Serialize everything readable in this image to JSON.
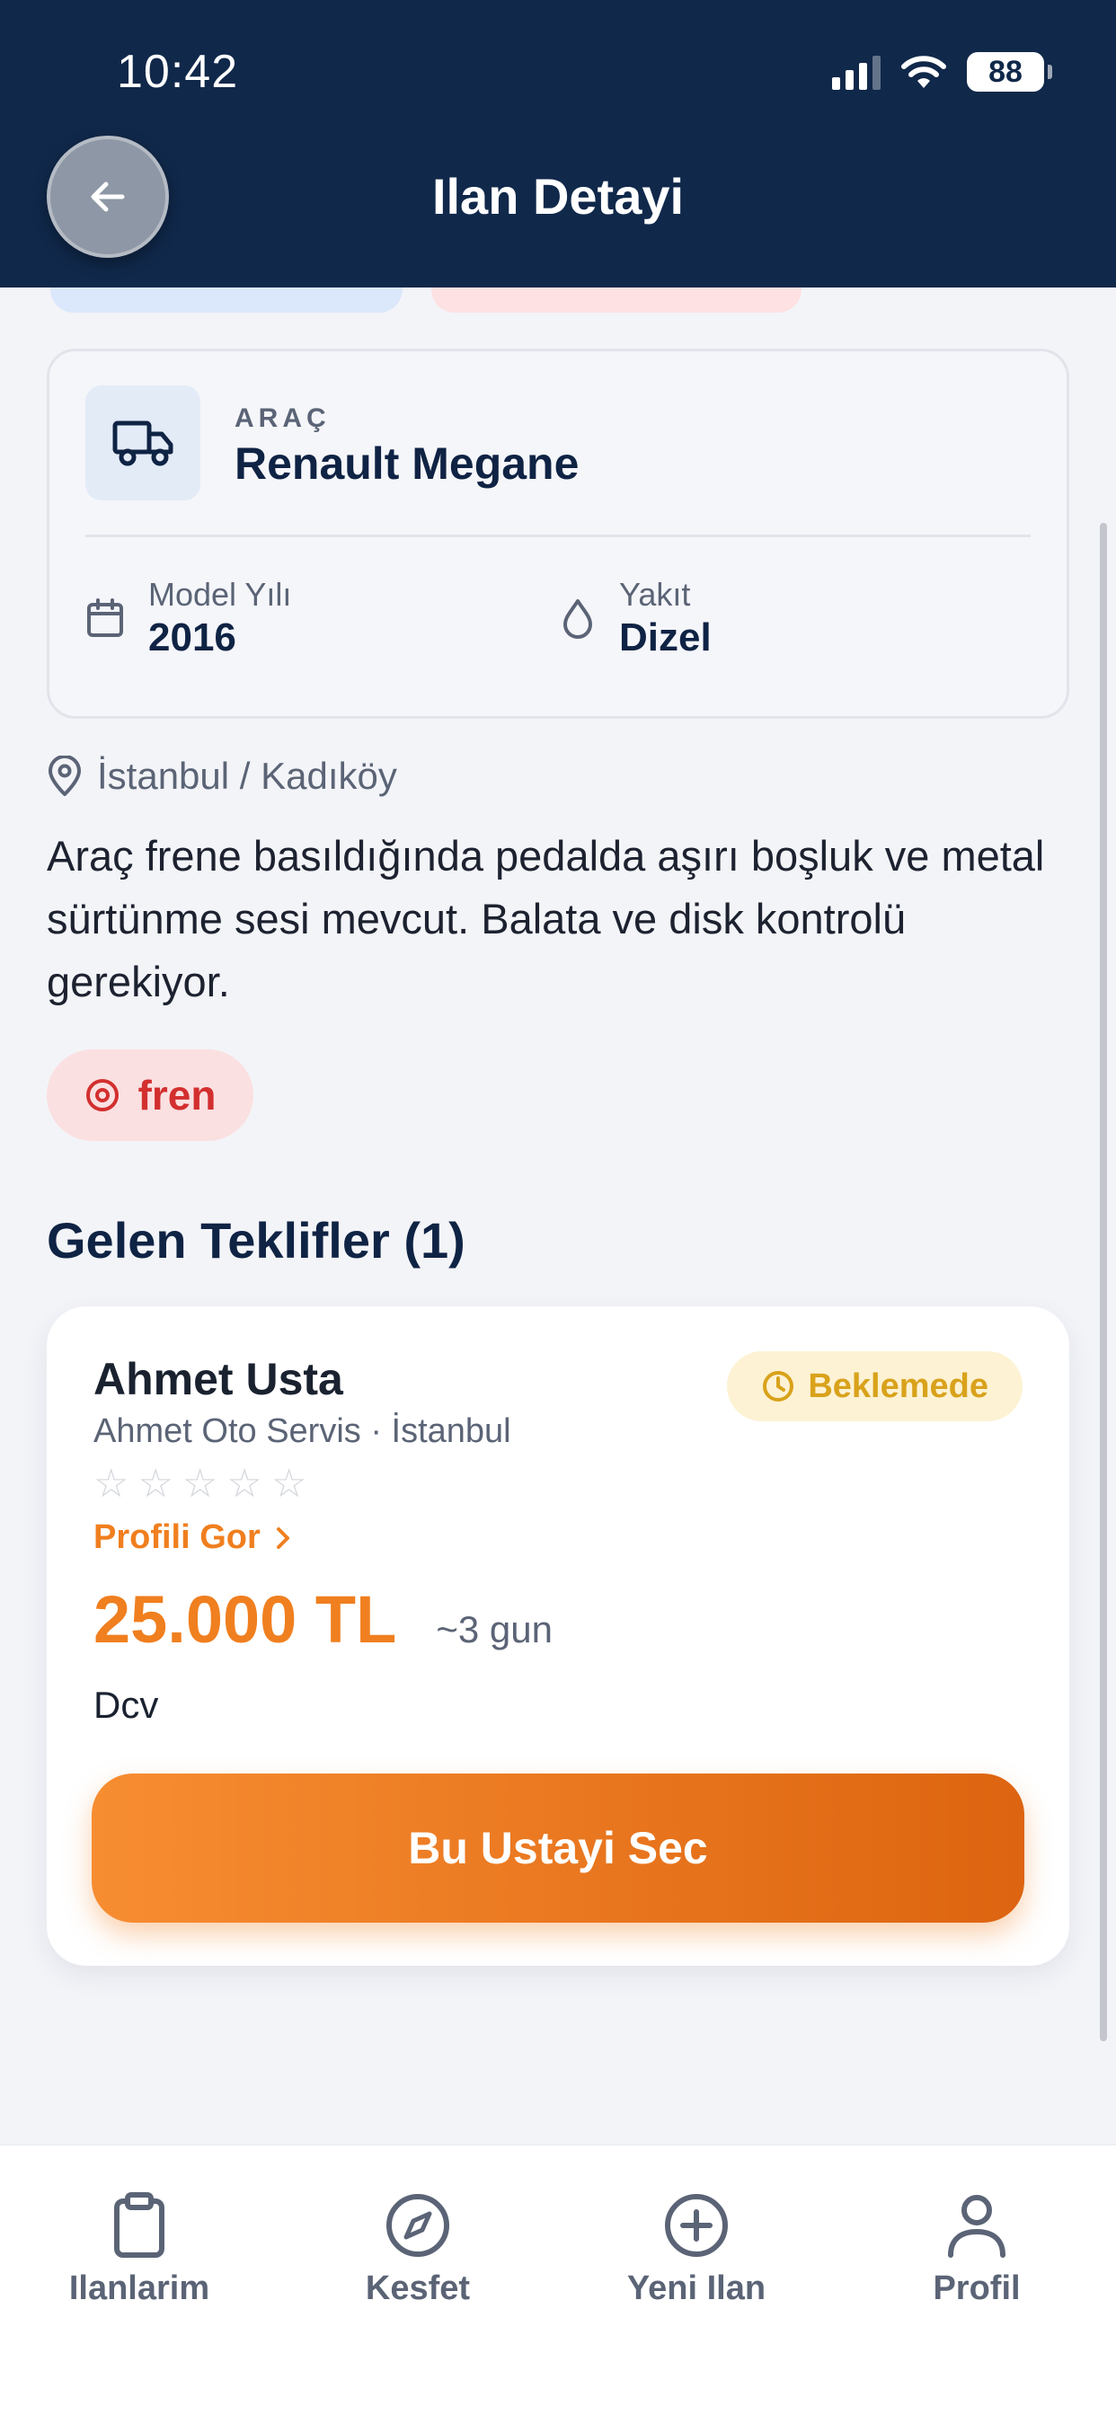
{
  "status_bar": {
    "time": "10:42",
    "battery": "88"
  },
  "header": {
    "title": "Ilan Detayi"
  },
  "vehicle": {
    "caption": "ARAÇ",
    "name": "Renault Megane",
    "year_label": "Model Yılı",
    "year_value": "2016",
    "fuel_label": "Yakıt",
    "fuel_value": "Dizel"
  },
  "listing": {
    "location": "İstanbul / Kadıköy",
    "description": "Araç frene basıldığında pedalda aşırı boşluk ve metal sürtünme sesi mevcut. Balata ve disk kontrolü gerekiyor.",
    "tag": "fren"
  },
  "offers": {
    "section_title": "Gelen Teklifler (1)",
    "items": [
      {
        "name": "Ahmet Usta",
        "shop": "Ahmet Oto Servis · İstanbul",
        "status": "Beklemede",
        "rating": 0,
        "rating_max": 5,
        "profile_link": "Profili Gor",
        "price": "25.000 TL",
        "duration": "~3 gun",
        "note": "Dcv",
        "select_label": "Bu Ustayi Sec"
      }
    ]
  },
  "nav": {
    "items": [
      {
        "label": "Ilanlarim",
        "icon": "clipboard-icon"
      },
      {
        "label": "Kesfet",
        "icon": "compass-icon"
      },
      {
        "label": "Yeni Ilan",
        "icon": "plus-circle-icon"
      },
      {
        "label": "Profil",
        "icon": "user-icon"
      }
    ]
  },
  "colors": {
    "header_bg": "#10284a",
    "accent_orange": "#f07f1f",
    "pending_yellow": "#d9a21b",
    "tag_red": "#d32f2f"
  }
}
